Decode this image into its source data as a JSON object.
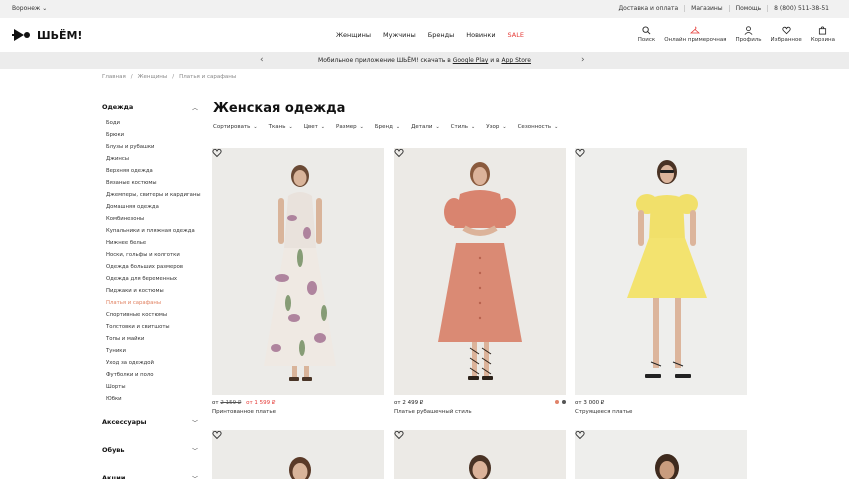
{
  "topbar": {
    "city": "Воронеж",
    "links": [
      "Доставка и оплата",
      "Магазины",
      "Помощь",
      "8 (800) 511-38-51"
    ]
  },
  "header": {
    "logo": "ШЬЁМ!",
    "nav": [
      "Женщины",
      "Мужчины",
      "Бренды",
      "Новинки",
      "SALE"
    ],
    "icons": [
      {
        "label": "Поиск",
        "icon": "search-icon"
      },
      {
        "label": "Онлайн примерочная",
        "icon": "hanger-icon"
      },
      {
        "label": "Профиль",
        "icon": "user-icon"
      },
      {
        "label": "Избранное",
        "icon": "heart-icon"
      },
      {
        "label": "Корзина",
        "icon": "bag-icon"
      }
    ]
  },
  "promo": {
    "text_before": "Мобильное приложение ШЬЁМ! скачать в ",
    "link1": "Google Play",
    "text_mid": " и в ",
    "link2": "App Store"
  },
  "breadcrumb": [
    "Главная",
    "Женщины",
    "Платья и сарафаны"
  ],
  "sidebar": {
    "clothing_title": "Одежда",
    "categories": [
      "Боди",
      "Брюки",
      "Блузы и рубашки",
      "Джинсы",
      "Верхняя одежда",
      "Вязаные костюмы",
      "Джемперы, свитеры и кардиганы",
      "Домашняя одежда",
      "Комбинезоны",
      "Купальники и пляжная одежда",
      "Нижнее белье",
      "Носки, гольфы и колготки",
      "Одежда больших размеров",
      "Одежда для беременных",
      "Пиджаки и костюмы",
      "Платья и сарафаны",
      "Спортивные костюмы",
      "Толстовки и свитшоты",
      "Топы и майки",
      "Туники",
      "Уход за одеждой",
      "Футболки и поло",
      "Шорты",
      "Юбки"
    ],
    "active_category": "Платья и сарафаны",
    "other_sections": [
      "Аксессуары",
      "Обувь",
      "Акции"
    ]
  },
  "main": {
    "title": "Женская одежда",
    "filters": [
      "Сортировать",
      "Ткань",
      "Цвет",
      "Размер",
      "Бренд",
      "Детали",
      "Стиль",
      "Узор",
      "Сезонность"
    ],
    "products": [
      {
        "price_prefix": "от",
        "old_price": "2 159 ₽",
        "new_price": "от 1 599 ₽",
        "name": "Принтованное платье"
      },
      {
        "price": "от 2 499 ₽",
        "name": "Платье рубашечный стиль",
        "swatches": [
          "#e0836a",
          "#555555"
        ]
      },
      {
        "price": "от 3 000 ₽",
        "name": "Струящееся платье"
      }
    ]
  },
  "colors": {
    "accent_sale": "#e53935",
    "active_category": "#e08060",
    "promo_bg": "#ececec",
    "topbar_bg": "#f1f1f1"
  }
}
